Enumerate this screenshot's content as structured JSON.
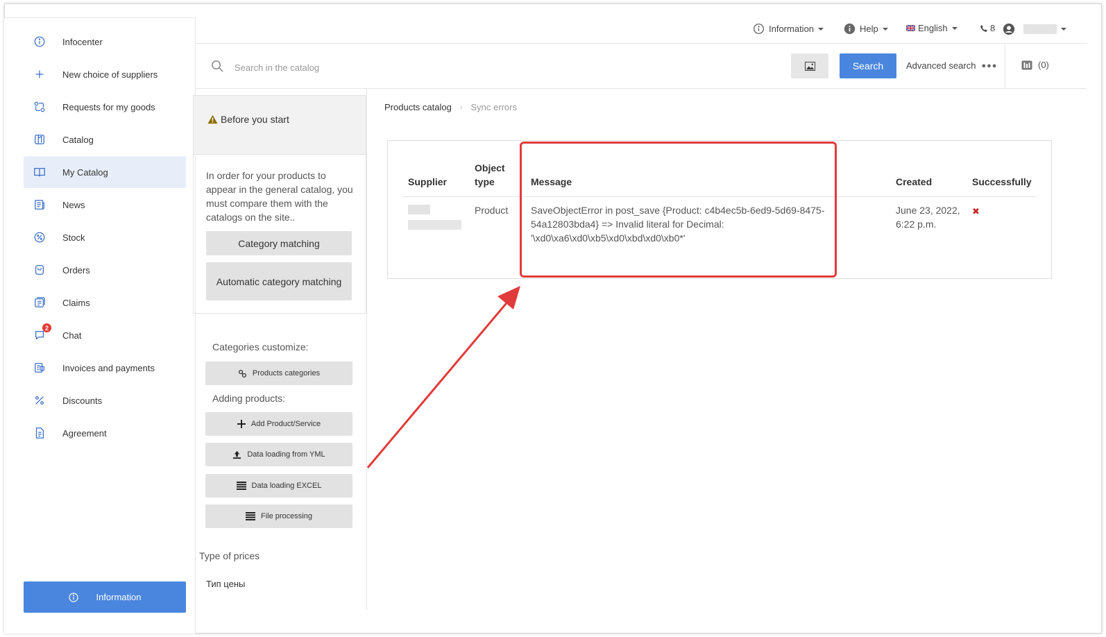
{
  "sidebar": {
    "items": [
      {
        "label": "Infocenter",
        "icon": "info-circle-icon"
      },
      {
        "label": "New choice of suppliers",
        "icon": "plus-icon"
      },
      {
        "label": "Requests for my goods",
        "icon": "exchange-icon"
      },
      {
        "label": "Catalog",
        "icon": "catalog-icon"
      },
      {
        "label": "My Catalog",
        "icon": "book-open-icon",
        "active": true
      },
      {
        "label": "News",
        "icon": "newspaper-icon"
      },
      {
        "label": "Stock",
        "icon": "percent-circle-icon"
      },
      {
        "label": "Orders",
        "icon": "shopping-bag-icon"
      },
      {
        "label": "Claims",
        "icon": "claims-icon"
      },
      {
        "label": "Chat",
        "icon": "chat-icon",
        "badge": "2"
      },
      {
        "label": "Invoices and payments",
        "icon": "invoice-icon"
      },
      {
        "label": "Discounts",
        "icon": "percent-icon"
      },
      {
        "label": "Agreement",
        "icon": "document-icon"
      }
    ],
    "info_button": "Information"
  },
  "topbar": {
    "information": "Information",
    "help": "Help",
    "language": "English",
    "phone": "8"
  },
  "search": {
    "placeholder": "Search in the catalog",
    "button": "Search",
    "advanced": "Advanced search",
    "compare_count": "(0)"
  },
  "panel": {
    "before_start": "Before you start",
    "intro_text": "In order for your products to appear in the general catalog, you must compare them with the catalogs on the site..",
    "category_matching": "Category matching",
    "auto_category_matching": "Automatic category matching",
    "categories_customize": "Categories customize:",
    "products_categories": "Products categories",
    "adding_products": "Adding products:",
    "add_product": "Add Product/Service",
    "data_yml": "Data loading from YML",
    "data_excel": "Data loading EXCEL",
    "file_processing": "File processing",
    "type_of_prices": "Type of prices",
    "price_type_name": "Тип цены"
  },
  "breadcrumb": {
    "parent": "Products catalog",
    "current": "Sync errors"
  },
  "table": {
    "headers": {
      "supplier": "Supplier",
      "object_type_1": "Object",
      "object_type_2": "type",
      "message": "Message",
      "created": "Created",
      "successfully": "Successfully"
    },
    "rows": [
      {
        "object_type": "Product",
        "message_line1": "SaveObjectError in post_save {Product: c4b4ec5b-6ed9-5d69-8475-",
        "message_line2": "54a12803bda4} => Invalid literal for Decimal:",
        "message_line3": "'\\xd0\\xa6\\xd0\\xb5\\xd0\\xbd\\xd0\\xb0*'",
        "created_line1": "June 23, 2022,",
        "created_line2": "6:22 p.m.",
        "success_mark": "✖"
      }
    ]
  },
  "colors": {
    "accent": "#4a86dd",
    "annotation": "#e03b3b",
    "error": "#c62828"
  }
}
